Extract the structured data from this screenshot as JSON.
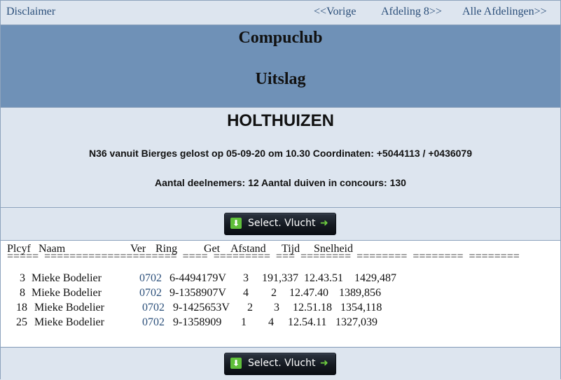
{
  "nav": {
    "disclaimer": "Disclaimer",
    "vorige": "<<Vorige",
    "afdeling": "Afdeling 8>>",
    "alle": "Alle Afdelingen>>"
  },
  "header": {
    "club": "Compuclub",
    "uitslag": "Uitslag"
  },
  "info": {
    "place": "HOLTHUIZEN",
    "flight": "N36 vanuit Bierges gelost op 05-09-20 om 10.30 Coordinaten: +5044113 / +0436079",
    "counts": "Aantal deelnemers: 12 Aantal duiven in concours: 130"
  },
  "buttons": {
    "select_label": "Select. Vlucht"
  },
  "table": {
    "headers": [
      "Plcyf",
      "Naam",
      "Ver",
      "Ring",
      "Get",
      "Afstand",
      "Tijd",
      "Snelheid"
    ],
    "separator": "=====  =====================  ====  =========  ===  ========  ========  ========  ========",
    "rows": [
      {
        "plc": "3",
        "naam": "Mieke Bodelier",
        "ver": "0702",
        "ring": "6-4494179V",
        "get": "3",
        "afstand": "191,337",
        "tijd": "12.43.51",
        "snelheid": "1429,487"
      },
      {
        "plc": "8",
        "naam": "Mieke Bodelier",
        "ver": "0702",
        "ring": "9-1358907V",
        "get": "4",
        "afstand": "2",
        "tijd": "12.47.40",
        "snelheid": "1389,856"
      },
      {
        "plc": "18",
        "naam": "Mieke Bodelier",
        "ver": "0702",
        "ring": "9-1425653V",
        "get": "2",
        "afstand": "3",
        "tijd": "12.51.18",
        "snelheid": "1354,118"
      },
      {
        "plc": "25",
        "naam": "Mieke Bodelier",
        "ver": "0702",
        "ring": "9-1358909",
        "get": "1",
        "afstand": "4",
        "tijd": "12.54.11",
        "snelheid": "1327,039"
      }
    ]
  }
}
